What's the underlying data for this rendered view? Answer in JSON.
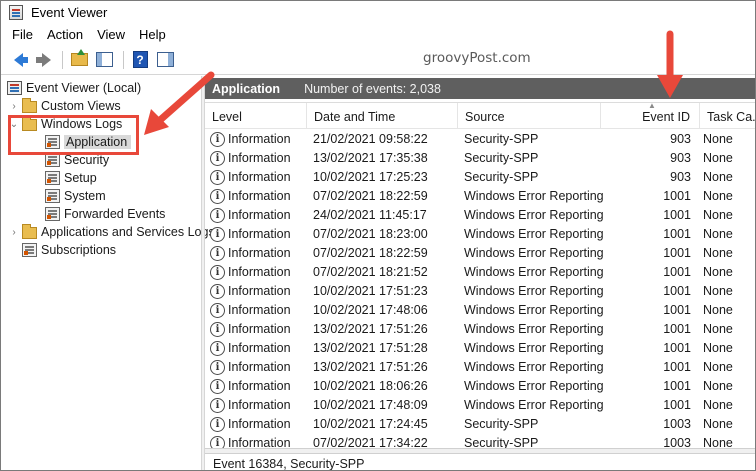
{
  "window": {
    "title": "Event Viewer"
  },
  "menu": [
    "File",
    "Action",
    "View",
    "Help"
  ],
  "toolbar": {
    "buttons": [
      "back-icon",
      "forward-icon",
      "up-folder-icon",
      "show-hide-tree-icon",
      "help-icon",
      "show-hide-action-pane-icon"
    ],
    "help_glyph": "?"
  },
  "watermark": "groovyPost.com",
  "tree": {
    "root": "Event Viewer (Local)",
    "custom_views": "Custom Views",
    "windows_logs": "Windows Logs",
    "application": "Application",
    "security": "Security",
    "setup": "Setup",
    "system": "System",
    "forwarded_events": "Forwarded Events",
    "apps_services": "Applications and Services Logs",
    "subscriptions": "Subscriptions"
  },
  "pane": {
    "title": "Application",
    "count": "Number of events: 2,038"
  },
  "columns": {
    "level": "Level",
    "date": "Date and Time",
    "source": "Source",
    "event_id": "Event ID",
    "task": "Task Ca..."
  },
  "rows": [
    {
      "level": "Information",
      "date": "21/02/2021 09:58:22",
      "source": "Security-SPP",
      "event_id": "903",
      "task": "None"
    },
    {
      "level": "Information",
      "date": "13/02/2021 17:35:38",
      "source": "Security-SPP",
      "event_id": "903",
      "task": "None"
    },
    {
      "level": "Information",
      "date": "10/02/2021 17:25:23",
      "source": "Security-SPP",
      "event_id": "903",
      "task": "None"
    },
    {
      "level": "Information",
      "date": "07/02/2021 18:22:59",
      "source": "Windows Error Reporting",
      "event_id": "1001",
      "task": "None"
    },
    {
      "level": "Information",
      "date": "24/02/2021 11:45:17",
      "source": "Windows Error Reporting",
      "event_id": "1001",
      "task": "None"
    },
    {
      "level": "Information",
      "date": "07/02/2021 18:23:00",
      "source": "Windows Error Reporting",
      "event_id": "1001",
      "task": "None"
    },
    {
      "level": "Information",
      "date": "07/02/2021 18:22:59",
      "source": "Windows Error Reporting",
      "event_id": "1001",
      "task": "None"
    },
    {
      "level": "Information",
      "date": "07/02/2021 18:21:52",
      "source": "Windows Error Reporting",
      "event_id": "1001",
      "task": "None"
    },
    {
      "level": "Information",
      "date": "10/02/2021 17:51:23",
      "source": "Windows Error Reporting",
      "event_id": "1001",
      "task": "None"
    },
    {
      "level": "Information",
      "date": "10/02/2021 17:48:06",
      "source": "Windows Error Reporting",
      "event_id": "1001",
      "task": "None"
    },
    {
      "level": "Information",
      "date": "13/02/2021 17:51:26",
      "source": "Windows Error Reporting",
      "event_id": "1001",
      "task": "None"
    },
    {
      "level": "Information",
      "date": "13/02/2021 17:51:28",
      "source": "Windows Error Reporting",
      "event_id": "1001",
      "task": "None"
    },
    {
      "level": "Information",
      "date": "13/02/2021 17:51:26",
      "source": "Windows Error Reporting",
      "event_id": "1001",
      "task": "None"
    },
    {
      "level": "Information",
      "date": "10/02/2021 18:06:26",
      "source": "Windows Error Reporting",
      "event_id": "1001",
      "task": "None"
    },
    {
      "level": "Information",
      "date": "10/02/2021 17:48:09",
      "source": "Windows Error Reporting",
      "event_id": "1001",
      "task": "None"
    },
    {
      "level": "Information",
      "date": "10/02/2021 17:24:45",
      "source": "Security-SPP",
      "event_id": "1003",
      "task": "None"
    },
    {
      "level": "Information",
      "date": "07/02/2021 17:34:22",
      "source": "Security-SPP",
      "event_id": "1003",
      "task": "None"
    }
  ],
  "details": {
    "title": "Event 16384, Security-SPP"
  },
  "colors": {
    "header_bg": "#5f5f5f",
    "annotation": "#e8483a",
    "selection": "#d9d9d9"
  }
}
